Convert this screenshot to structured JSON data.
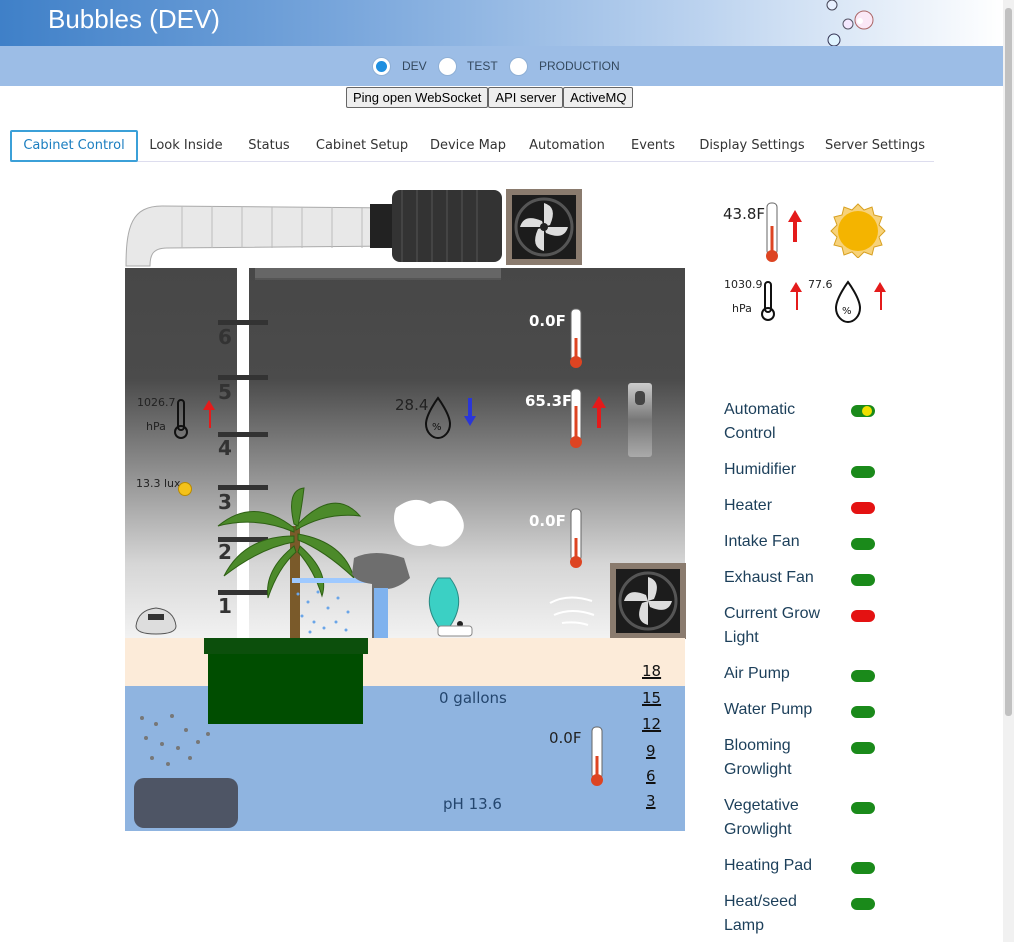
{
  "app": {
    "title": "Bubbles (DEV)"
  },
  "env": {
    "options": [
      {
        "label": "DEV",
        "selected": true
      },
      {
        "label": "TEST",
        "selected": false
      },
      {
        "label": "PRODUCTION",
        "selected": false
      }
    ]
  },
  "actions": {
    "ping": "Ping open WebSocket",
    "api": "API server",
    "mq": "ActiveMQ"
  },
  "tabs": [
    "Cabinet Control",
    "Look Inside",
    "Status",
    "Cabinet Setup",
    "Device Map",
    "Automation",
    "Events",
    "Display Settings",
    "Server Settings"
  ],
  "outside": {
    "temp": "43.8F",
    "pressure": "1030.9",
    "pressure_unit": "hPa",
    "humidity": "77.6"
  },
  "cabinet": {
    "pressure": "1026.7",
    "pressure_unit": "hPa",
    "lux": "13.3 lux",
    "humidity": "28.4",
    "temp_top": "0.0F",
    "temp_upper": "65.3F",
    "temp_lower": "0.0F",
    "shelf_numbers": [
      "6",
      "5",
      "4",
      "3",
      "2",
      "1"
    ]
  },
  "reservoir": {
    "gallons": "0 gallons",
    "temp": "0.0F",
    "ph": "pH 13.6",
    "levels": [
      "18",
      "15",
      "12",
      "9",
      "6",
      "3"
    ]
  },
  "devices": [
    {
      "label": "Automatic Control",
      "state": "auto"
    },
    {
      "label": "Humidifier",
      "state": "on"
    },
    {
      "label": "Heater",
      "state": "off"
    },
    {
      "label": "Intake Fan",
      "state": "on"
    },
    {
      "label": "Exhaust Fan",
      "state": "on"
    },
    {
      "label": "Current Grow Light",
      "state": "off"
    },
    {
      "label": "Air Pump",
      "state": "on"
    },
    {
      "label": "Water Pump",
      "state": "on"
    },
    {
      "label": "Blooming Growlight",
      "state": "on"
    },
    {
      "label": "Vegetative Growlight",
      "state": "on"
    },
    {
      "label": "Heating Pad",
      "state": "on"
    },
    {
      "label": "Heat/seed Lamp",
      "state": "on"
    }
  ],
  "colors": {
    "on": "#1a8a1a",
    "off": "#e41212",
    "active_tab": "#3ba0d8",
    "header": "#3f80c8",
    "envbar": "#9cbde6"
  }
}
